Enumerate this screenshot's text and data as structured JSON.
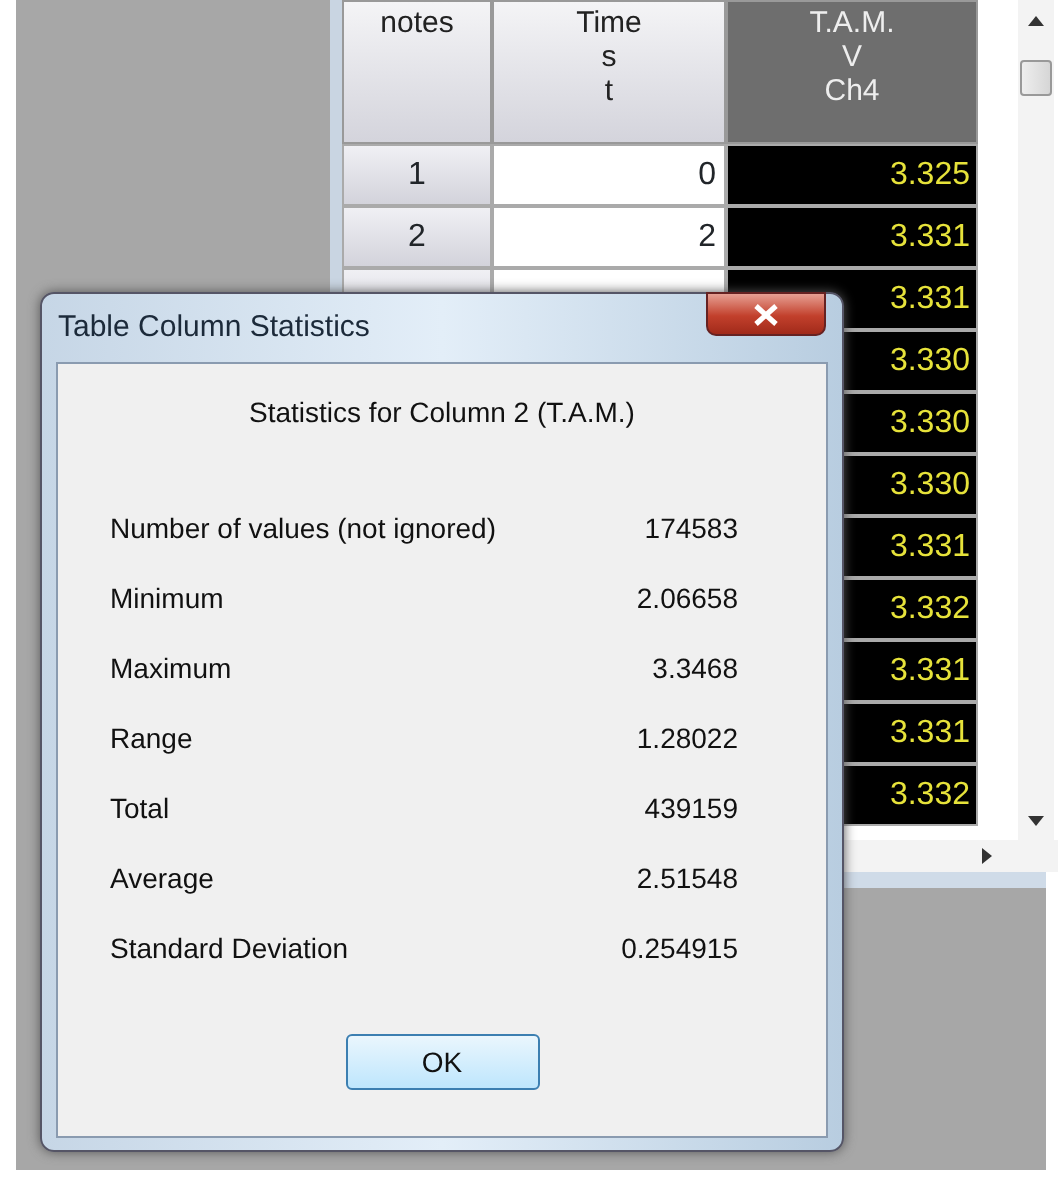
{
  "table": {
    "columns": [
      {
        "lines": [
          "notes"
        ],
        "kind": "header"
      },
      {
        "lines": [
          "Time",
          "s",
          "t"
        ],
        "kind": "normal"
      },
      {
        "lines": [
          "T.A.M.",
          "V",
          "Ch4"
        ],
        "kind": "selected"
      }
    ],
    "rows": [
      {
        "notes": "1",
        "time": "0",
        "value": "3.325"
      },
      {
        "notes": "2",
        "time": "2",
        "value": "3.331"
      },
      {
        "value": "3.331"
      },
      {
        "value": "3.330"
      },
      {
        "value": "3.330"
      },
      {
        "value": "3.330"
      },
      {
        "value": "3.331"
      },
      {
        "value": "3.332"
      },
      {
        "value": "3.331"
      },
      {
        "value": "3.331"
      },
      {
        "value": "3.332"
      }
    ]
  },
  "dialog": {
    "title": "Table Column Statistics",
    "heading": "Statistics for Column 2 (T.A.M.)",
    "stats": [
      {
        "label": "Number of values (not ignored)",
        "value": "174583"
      },
      {
        "label": "Minimum",
        "value": "2.06658"
      },
      {
        "label": "Maximum",
        "value": "3.3468"
      },
      {
        "label": "Range",
        "value": "1.28022"
      },
      {
        "label": "Total",
        "value": "439159"
      },
      {
        "label": "Average",
        "value": "2.51548"
      },
      {
        "label": "Standard Deviation",
        "value": "0.254915"
      }
    ],
    "button": "OK"
  }
}
